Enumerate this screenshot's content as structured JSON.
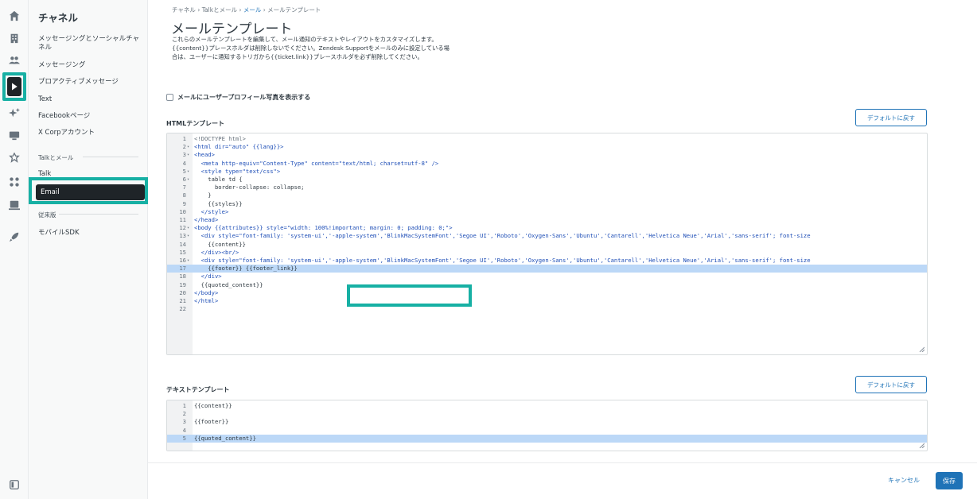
{
  "nav": {
    "title": "チャネル",
    "items": [
      {
        "label": "メッセージングとソーシャルチャネル"
      },
      {
        "label": "メッセージング"
      },
      {
        "label": "プロアクティブメッセージ"
      },
      {
        "label": "Text"
      },
      {
        "label": "Facebookページ"
      },
      {
        "label": "X Corpアカウント"
      }
    ],
    "section_talk": "Talkとメール",
    "talk": "Talk",
    "email": "Email",
    "section_legacy": "従来版",
    "mobile_sdk": "モバイルSDK"
  },
  "rail_icons": [
    "home-icon",
    "building-icon",
    "people-icon",
    "channels-icon",
    "sparkle-icon",
    "monitor-icon",
    "objects-icon",
    "apps-icon",
    "workspace-icon",
    "rocket-icon",
    "collapse-icon"
  ],
  "breadcrumb": {
    "items": [
      "チャネル",
      "Talkとメール",
      "メール",
      "メールテンプレート"
    ],
    "separator": "›"
  },
  "page": {
    "title": "メールテンプレート",
    "description": "これらのメールテンプレートを編集して、メール通知のテキストやレイアウトをカスタマイズします。{{content}}プレースホルダは削除しないでください。Zendesk Supportをメールのみに設定している場合は、ユーザーに通知するトリガから{{ticket.link}}プレースホルダを必ず削除してください。",
    "checkbox_label": "メールにユーザープロフィール写真を表示する",
    "checkbox_checked": false
  },
  "html_template": {
    "label": "HTMLテンプレート",
    "reset_label": "デフォルトに戻す",
    "active_line": 17,
    "lines": [
      "<!DOCTYPE html>",
      "<html dir=\"auto\" {{lang}}>",
      "<head>",
      "  <meta http-equiv=\"Content-Type\" content=\"text/html; charset=utf-8\" />",
      "  <style type=\"text/css\">",
      "    table td {",
      "      border-collapse: collapse;",
      "    }",
      "    {{styles}}",
      "  </style>",
      "</head>",
      "<body {{attributes}} style=\"width: 100%!important; margin: 0; padding: 0;\">",
      "  <div style=\"font-family: 'system-ui','-apple-system','BlinkMacSystemFont','Segoe UI','Roboto','Oxygen-Sans','Ubuntu','Cantarell','Helvetica Neue','Arial','sans-serif'; font-size",
      "    {{content}}",
      "  </div><br/>",
      "  <div style=\"font-family: 'system-ui','-apple-system','BlinkMacSystemFont','Segoe UI','Roboto','Oxygen-Sans','Ubuntu','Cantarell','Helvetica Neue','Arial','sans-serif'; font-size",
      "    {{footer}} {{footer_link}}",
      "  </div>",
      "  {{quoted_content}}",
      "</body>",
      "</html>",
      ""
    ],
    "fold_lines": [
      2,
      3,
      5,
      6,
      12,
      13,
      16
    ]
  },
  "text_template": {
    "label": "テキストテンプレート",
    "reset_label": "デフォルトに戻す",
    "active_line": 5,
    "lines": [
      "{{content}}",
      "",
      "{{footer}}",
      "",
      "{{quoted_content}}"
    ]
  },
  "footer": {
    "cancel_label": "キャンセル",
    "save_label": "保存"
  },
  "colors": {
    "accent": "#1f73b7",
    "highlight": "#17b0a4",
    "selected_nav": "#1f2428",
    "active_line": "#bcd8f7"
  }
}
